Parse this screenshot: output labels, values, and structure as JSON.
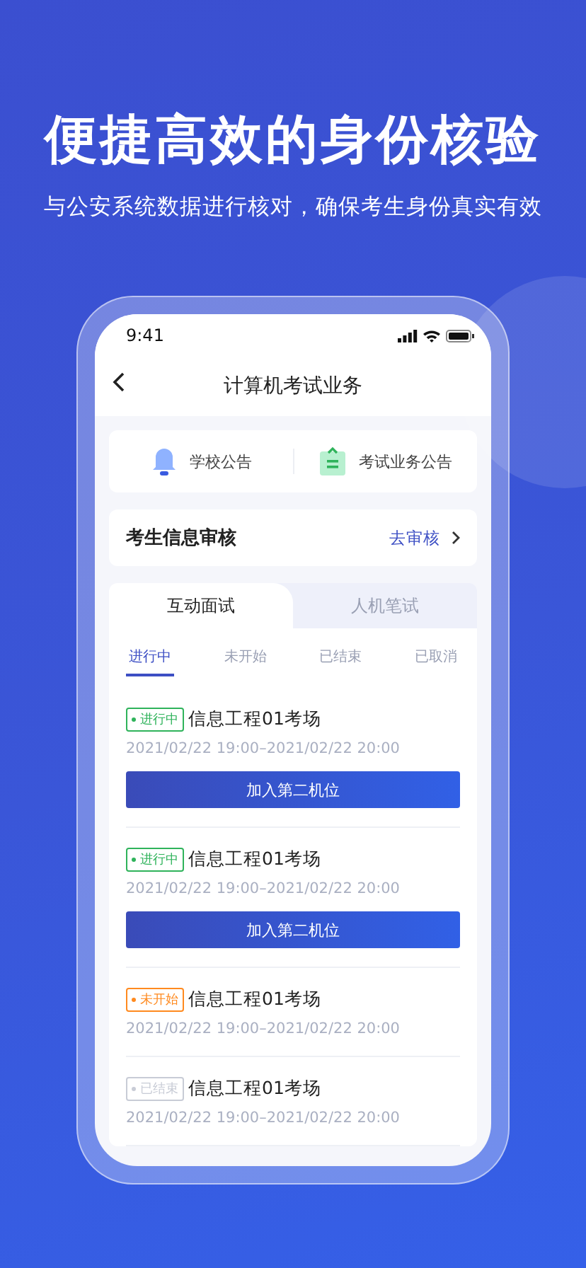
{
  "headline": "便捷高效的身份核验",
  "subtitle": "与公安系统数据进行核对，确保考生身份真实有效",
  "phone": {
    "time": "9:41",
    "title": "计算机考试业务",
    "notices": [
      {
        "kind": "bell",
        "label": "学校公告"
      },
      {
        "kind": "clipboard",
        "label": "考试业务公告"
      }
    ],
    "review": {
      "label": "考生信息审核",
      "action": "去审核"
    },
    "exam_tabs": [
      {
        "label": "互动面试",
        "selected": true
      },
      {
        "label": "人机笔试",
        "selected": false
      }
    ],
    "status_tabs": [
      {
        "label": "进行中",
        "selected": true
      },
      {
        "label": "未开始",
        "selected": false
      },
      {
        "label": "已结束",
        "selected": false
      },
      {
        "label": "已取消",
        "selected": false
      }
    ],
    "sessions": [
      {
        "status": "进行中",
        "color": "#2fb35b",
        "name": "信息工程01考场",
        "time": "2021/02/22 19:00–2021/02/22 20:00",
        "button": "加入第二机位"
      },
      {
        "status": "进行中",
        "color": "#2fb35b",
        "name": "信息工程01考场",
        "time": "2021/02/22 19:00–2021/02/22 20:00",
        "button": "加入第二机位"
      },
      {
        "status": "未开始",
        "color": "#ff8a1f",
        "name": "信息工程01考场",
        "time": "2021/02/22 19:00–2021/02/22 20:00"
      },
      {
        "status": "已结束",
        "color": "#c8ccd6",
        "name": "信息工程01考场",
        "time": "2021/02/22 19:00–2021/02/22 20:00"
      }
    ]
  }
}
